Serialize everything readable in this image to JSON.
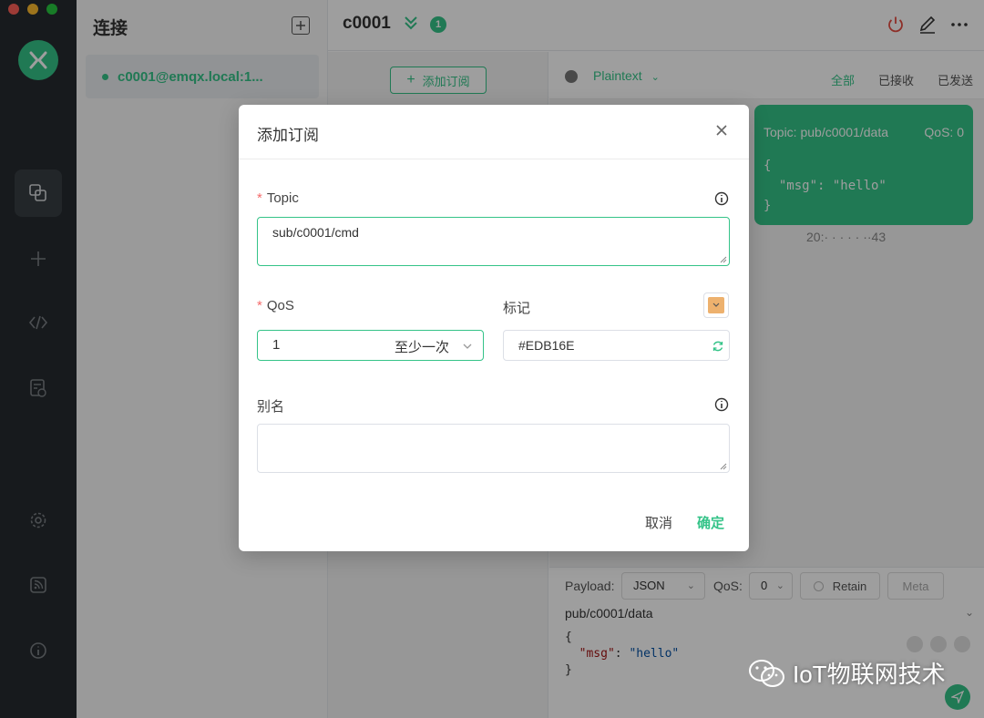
{
  "window": {
    "traffic_colors": [
      "#fe5f57",
      "#febc2e",
      "#28c840"
    ]
  },
  "connections": {
    "title": "连接",
    "items": [
      {
        "label": "c0001@emqx.local:1..."
      }
    ]
  },
  "topbar": {
    "client_name": "c0001",
    "badge_count": "1"
  },
  "subscriptions": {
    "add_button_label": "添加订阅"
  },
  "messages": {
    "format": "Plaintext",
    "filters": [
      "全部",
      "已接收",
      "已发送"
    ],
    "bubble": {
      "topic": "Topic: pub/c0001/data",
      "qos": "QoS: 0",
      "payload": "{\n  \"msg\": \"hello\"\n}",
      "time": "20:· ·  ·  · · ··43"
    }
  },
  "publish": {
    "payload_label": "Payload:",
    "payload_format": "JSON",
    "qos_label": "QoS:",
    "qos_value": "0",
    "retain_label": "Retain",
    "meta_label": "Meta",
    "topic": "pub/c0001/data",
    "body_open": "{",
    "body_key": "\"msg\"",
    "body_colon": ": ",
    "body_value": "\"hello\"",
    "body_close": "}"
  },
  "dialog": {
    "title": "添加订阅",
    "topic_label": "Topic",
    "topic_value": "sub/c0001/cmd",
    "qos_label": "QoS",
    "qos_value": "1",
    "qos_desc": "至少一次",
    "tag_label": "标记",
    "tag_color": "#EDB16E",
    "alias_label": "别名",
    "alias_value": "",
    "cancel_label": "取消",
    "confirm_label": "确定"
  },
  "watermark": {
    "text": "IoT物联网技术"
  },
  "colors": {
    "accent": "#34c388",
    "sidebar": "#262b2f",
    "danger": "#e54d42"
  }
}
